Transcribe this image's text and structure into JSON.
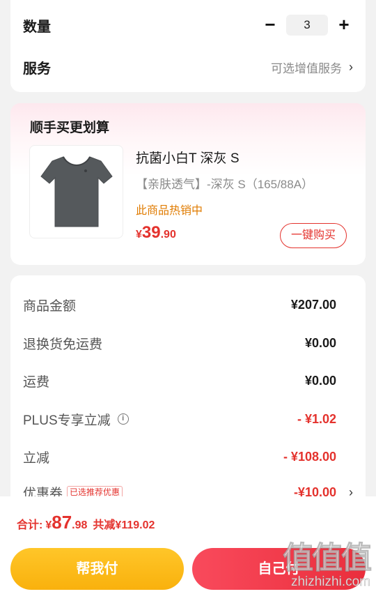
{
  "quantity": {
    "label": "数量",
    "minus": "−",
    "value": "3",
    "plus": "+"
  },
  "service": {
    "label": "服务",
    "hint": "可选增值服务",
    "chevron": "›"
  },
  "upsell": {
    "title": "顺手买更划算",
    "product": {
      "image_icon": "tshirt-icon",
      "name": "抗菌小白T 深灰 S",
      "spec": "【亲肤透气】-深灰   S（165/88A）",
      "hot": "此商品热销中",
      "price_currency": "¥",
      "price_int": "39",
      "price_dec": ".90",
      "buy_label": "一键购买"
    }
  },
  "summary": {
    "rows": [
      {
        "label": "商品金额",
        "value": "¥207.00"
      },
      {
        "label": "退换货免运费",
        "value": "¥0.00"
      },
      {
        "label": "运费",
        "value": "¥0.00"
      },
      {
        "label": "PLUS专享立减",
        "value": "- ¥1.02"
      },
      {
        "label": "立减",
        "value": "- ¥108.00"
      },
      {
        "label": "优惠券",
        "tag": "已选推荐优惠",
        "value": "-¥10.00",
        "chevron": "›"
      }
    ]
  },
  "footer": {
    "total_label": "合计:",
    "total_currency": "¥",
    "total_int": "87",
    "total_dec": ".98",
    "saved": "共减¥119.02",
    "help_pay": "帮我付",
    "self_pay": "自己付"
  },
  "watermark": {
    "logo": "值值值",
    "url": "zhizhizhi.com"
  },
  "colors": {
    "accent_red": "#e4322d",
    "hot_orange": "#e07b00",
    "help_yellow": "#f9b10d",
    "self_red": "#ea2e3c"
  }
}
